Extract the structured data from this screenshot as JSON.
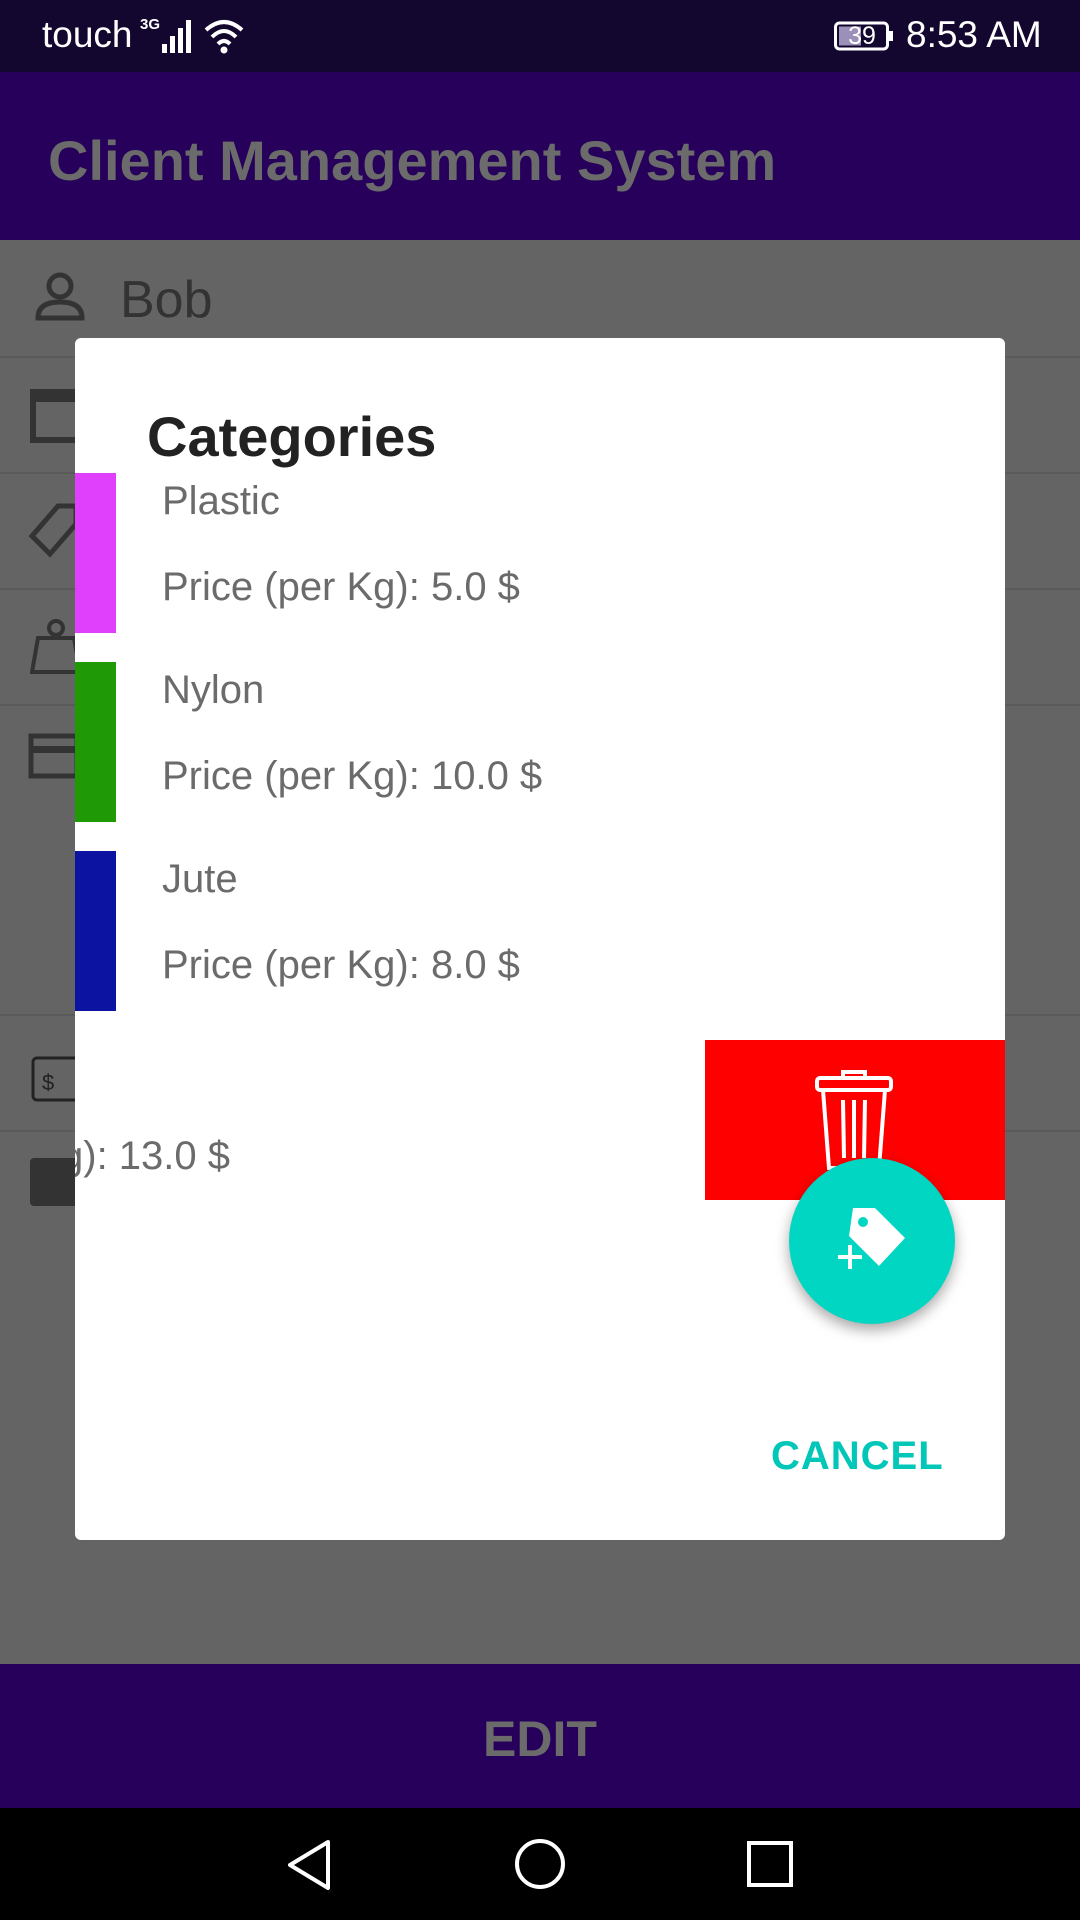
{
  "status_bar": {
    "carrier": "touch",
    "network": "3G",
    "battery": "39",
    "time": "8:53 AM"
  },
  "app_bar": {
    "title": "Client Management System"
  },
  "background_form": {
    "client_name": "Bob",
    "partial_text": "$"
  },
  "dialog": {
    "title": "Categories",
    "categories": [
      {
        "name": "Plastic",
        "price": "Price (per Kg): 5.0 $",
        "color": "#e040fb"
      },
      {
        "name": "Nylon",
        "price": "Price (per Kg): 10.0 $",
        "color": "#1f9a06"
      },
      {
        "name": "Jute",
        "price": "Price (per Kg): 8.0 $",
        "color": "#0d13a1"
      }
    ],
    "swiped_item_price": "g): 13.0 $",
    "delete_color": "#ff0000",
    "cancel_label": "CANCEL",
    "fab_icon": "add-tag-icon"
  },
  "edit_bar": {
    "label": "EDIT"
  },
  "nav": {
    "back_icon": "back-icon",
    "home_icon": "home-icon",
    "recents_icon": "recents-icon"
  }
}
